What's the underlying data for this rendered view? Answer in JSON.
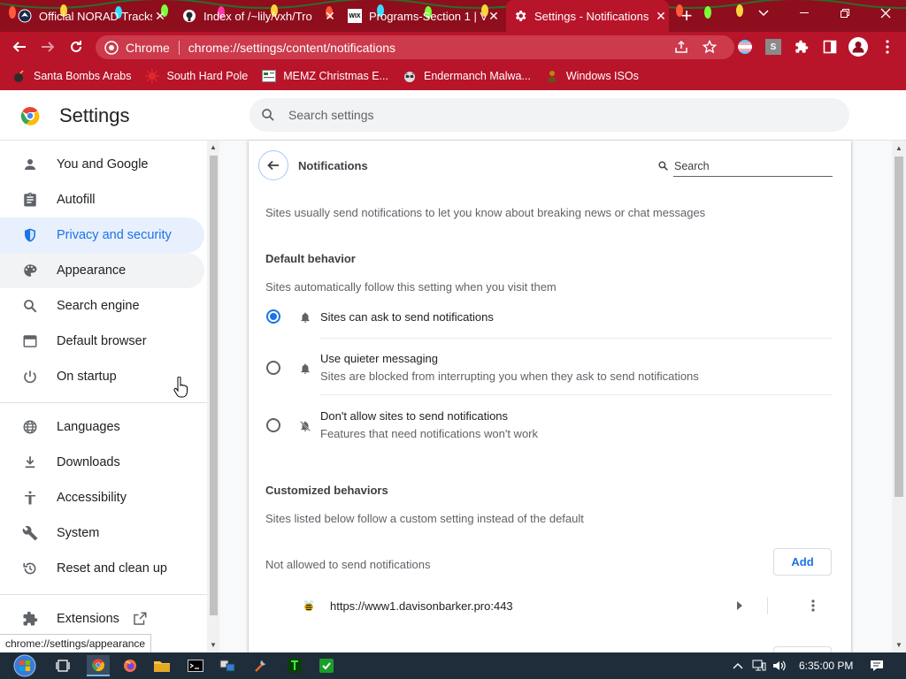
{
  "browser": {
    "tabs": [
      {
        "label": "Official NORAD Tracks",
        "active": false,
        "favicon": "norad-icon"
      },
      {
        "label": "Index of /~lily/vxh/Tro",
        "active": false,
        "favicon": "github-icon"
      },
      {
        "label": "Programs-Section 1 | V",
        "active": false,
        "favicon": "wix-icon"
      },
      {
        "label": "Settings - Notifications",
        "active": true,
        "favicon": "gear-icon"
      }
    ],
    "new_tab": "+",
    "favicon_wix_text": "WIX",
    "address_chip": "Chrome",
    "address_url": "chrome://settings/content/notifications",
    "profile_ext_letter": "S",
    "bookmarks": [
      {
        "label": "Santa Bombs Arabs",
        "icon": "bomb-icon"
      },
      {
        "label": "South Hard Pole",
        "icon": "virus-icon"
      },
      {
        "label": "MEMZ Christmas E...",
        "icon": "file-icon"
      },
      {
        "label": "Endermanch Malwa...",
        "icon": "raccoon-icon"
      },
      {
        "label": "Windows ISOs",
        "icon": "person-icon"
      }
    ]
  },
  "settings": {
    "title": "Settings",
    "search_placeholder": "Search settings",
    "nav": [
      {
        "label": "You and Google",
        "icon": "person-icon"
      },
      {
        "label": "Autofill",
        "icon": "clipboard-icon"
      },
      {
        "label": "Privacy and security",
        "icon": "shield-icon"
      },
      {
        "label": "Appearance",
        "icon": "palette-icon"
      },
      {
        "label": "Search engine",
        "icon": "search-icon"
      },
      {
        "label": "Default browser",
        "icon": "browser-window-icon"
      },
      {
        "label": "On startup",
        "icon": "power-icon"
      },
      {
        "label": "Languages",
        "icon": "globe-icon"
      },
      {
        "label": "Downloads",
        "icon": "download-icon"
      },
      {
        "label": "Accessibility",
        "icon": "accessibility-icon"
      },
      {
        "label": "System",
        "icon": "wrench-icon"
      },
      {
        "label": "Reset and clean up",
        "icon": "history-icon"
      },
      {
        "label": "Extensions",
        "icon": "puzzle-icon"
      }
    ],
    "selected_nav": "Privacy and security",
    "hovered_nav": "Appearance"
  },
  "notifications": {
    "title": "Notifications",
    "search_placeholder": "Search",
    "intro": "Sites usually send notifications to let you know about breaking news or chat messages",
    "default_heading": "Default behavior",
    "default_desc": "Sites automatically follow this setting when you visit them",
    "options": [
      {
        "label": "Sites can ask to send notifications",
        "sub": "",
        "selected": true,
        "icon": "bell-icon"
      },
      {
        "label": "Use quieter messaging",
        "sub": "Sites are blocked from interrupting you when they ask to send notifications",
        "selected": false,
        "icon": "bell-icon"
      },
      {
        "label": "Don't allow sites to send notifications",
        "sub": "Features that need notifications won't work",
        "selected": false,
        "icon": "bell-off-icon"
      }
    ],
    "custom_heading": "Customized behaviors",
    "custom_desc": "Sites listed below follow a custom setting instead of the default",
    "not_allowed_label": "Not allowed to send notifications",
    "add_label": "Add",
    "blocked_sites": [
      "https://www1.davisonbarker.pro:443"
    ]
  },
  "status_bar_url": "chrome://settings/appearance",
  "taskbar": {
    "clock": "6:35:00 PM",
    "apps": [
      "start-button",
      "task-view",
      "chrome",
      "firefox",
      "file-explorer",
      "command-prompt",
      "network-app",
      "tools-app",
      "terminal-app",
      "green-app"
    ]
  },
  "colors": {
    "accent": "#1a73e8",
    "tabstrip": "#8e0e1d",
    "toolbar": "#b8142a",
    "selected_nav_bg": "#e8f0fe"
  }
}
